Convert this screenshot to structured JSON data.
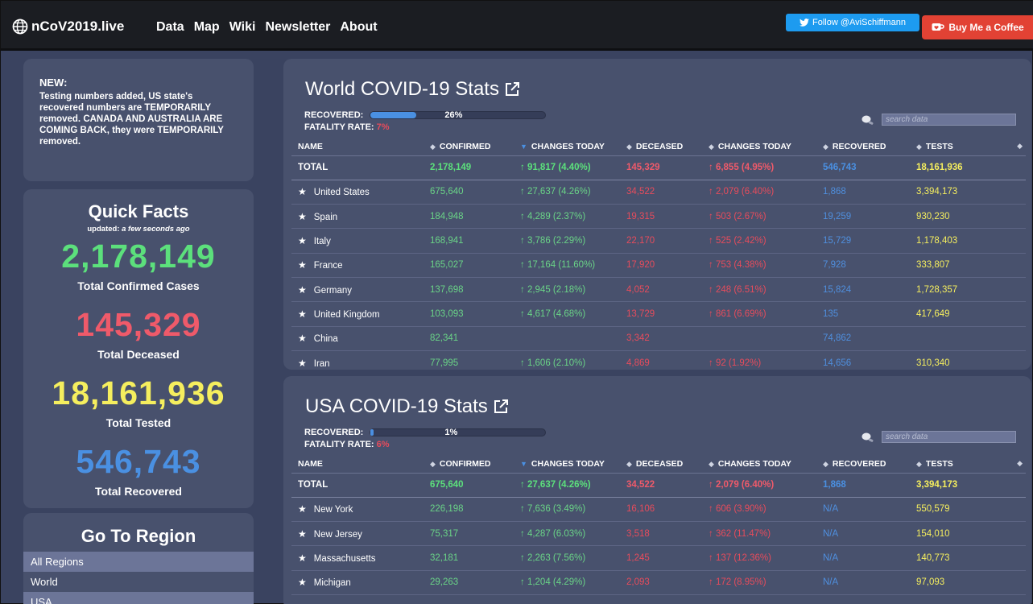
{
  "nav": {
    "brand": "nCoV2019.live",
    "links": [
      "Data",
      "Map",
      "Wiki",
      "Newsletter",
      "About"
    ],
    "twitter_label": "Follow @AviSchiffmann",
    "coffee_label": "Buy Me a Coffee"
  },
  "news": {
    "title": "NEW:",
    "body": "Testing numbers added, US state's recovered numbers are TEMPORARILY removed. CANADA AND AUSTRALIA ARE COMING BACK, they were TEMPORARILY removed."
  },
  "facts": {
    "title": "Quick Facts",
    "updated_prefix": "updated: ",
    "updated_value": "a few seconds ago",
    "confirmed": "2,178,149",
    "confirmed_label": "Total Confirmed Cases",
    "deceased": "145,329",
    "deceased_label": "Total Deceased",
    "tested": "18,161,936",
    "tested_label": "Total Tested",
    "recovered": "546,743",
    "recovered_label": "Total Recovered",
    "colors": {
      "confirmed": "#5ce07c",
      "deceased": "#ef5a6a",
      "tested": "#f5ee5e",
      "recovered": "#4a90e2"
    }
  },
  "region": {
    "title": "Go To Region",
    "items": [
      "All Regions",
      "World",
      "USA"
    ]
  },
  "headers": [
    "NAME",
    "CONFIRMED",
    "CHANGES TODAY",
    "DECEASED",
    "CHANGES TODAY",
    "RECOVERED",
    "TESTS"
  ],
  "world": {
    "title": "World COVID-19 Stats",
    "recovered_label": "RECOVERED:",
    "recovered_pct": "26%",
    "recovered_fraction": 0.26,
    "fatality_label": "FATALITY RATE: ",
    "fatality_pct": "7%",
    "search_placeholder": "search data",
    "total": [
      "TOTAL",
      "2,178,149",
      "↑ 91,817 (4.40%)",
      "145,329",
      "↑ 6,855 (4.95%)",
      "546,743",
      "18,161,936"
    ],
    "rows": [
      [
        "United States",
        "675,640",
        "↑ 27,637 (4.26%)",
        "34,522",
        "↑ 2,079 (6.40%)",
        "1,868",
        "3,394,173"
      ],
      [
        "Spain",
        "184,948",
        "↑ 4,289 (2.37%)",
        "19,315",
        "↑ 503 (2.67%)",
        "19,259",
        "930,230"
      ],
      [
        "Italy",
        "168,941",
        "↑ 3,786 (2.29%)",
        "22,170",
        "↑ 525 (2.42%)",
        "15,729",
        "1,178,403"
      ],
      [
        "France",
        "165,027",
        "↑ 17,164 (11.60%)",
        "17,920",
        "↑ 753 (4.38%)",
        "7,928",
        "333,807"
      ],
      [
        "Germany",
        "137,698",
        "↑ 2,945 (2.18%)",
        "4,052",
        "↑ 248 (6.51%)",
        "15,824",
        "1,728,357"
      ],
      [
        "United Kingdom",
        "103,093",
        "↑ 4,617 (4.68%)",
        "13,729",
        "↑ 861 (6.69%)",
        "135",
        "417,649"
      ],
      [
        "China",
        "82,341",
        "",
        "3,342",
        "",
        "74,862",
        ""
      ],
      [
        "Iran",
        "77,995",
        "↑ 1,606 (2.10%)",
        "4,869",
        "↑ 92 (1.92%)",
        "14,656",
        "310,340"
      ]
    ]
  },
  "usa": {
    "title": "USA COVID-19 Stats",
    "recovered_label": "RECOVERED:",
    "recovered_pct": "1%",
    "recovered_fraction": 0.01,
    "fatality_label": "FATALITY RATE: ",
    "fatality_pct": "6%",
    "search_placeholder": "search data",
    "total": [
      "TOTAL",
      "675,640",
      "↑ 27,637 (4.26%)",
      "34,522",
      "↑ 2,079 (6.40%)",
      "1,868",
      "3,394,173"
    ],
    "rows": [
      [
        "New York",
        "226,198",
        "↑ 7,636 (3.49%)",
        "16,106",
        "↑ 606 (3.90%)",
        "N/A",
        "550,579"
      ],
      [
        "New Jersey",
        "75,317",
        "↑ 4,287 (6.03%)",
        "3,518",
        "↑ 362 (11.47%)",
        "N/A",
        "154,010"
      ],
      [
        "Massachusetts",
        "32,181",
        "↑ 2,263 (7.56%)",
        "1,245",
        "↑ 137 (12.36%)",
        "N/A",
        "140,773"
      ],
      [
        "Michigan",
        "29,263",
        "↑ 1,204 (4.29%)",
        "2,093",
        "↑ 172 (8.95%)",
        "N/A",
        "97,093"
      ]
    ]
  }
}
